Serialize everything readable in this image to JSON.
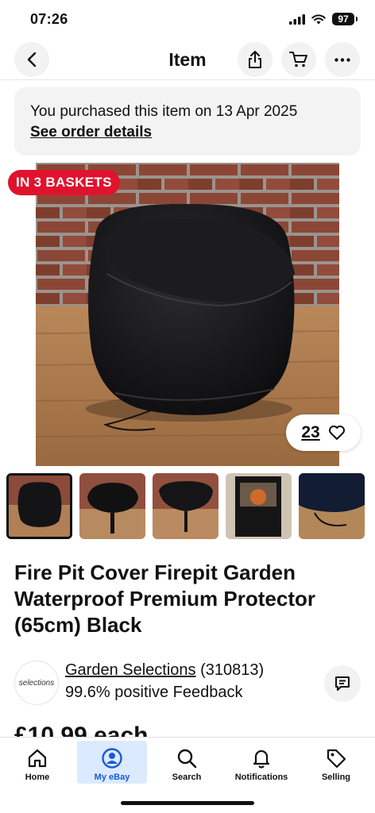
{
  "status_bar": {
    "time": "07:26",
    "battery": "97"
  },
  "nav": {
    "title": "Item",
    "back_icon": "chevron-left-icon",
    "share_icon": "share-icon",
    "cart_icon": "cart-icon",
    "more_icon": "more-icon"
  },
  "purchase": {
    "text": "You purchased this item on 13 Apr 2025",
    "link": "See order details"
  },
  "hero": {
    "badge": "IN 3 BASKETS",
    "watch_count": "23",
    "watch_icon": "heart-icon"
  },
  "thumbnails": [
    {
      "name": "thumb-cover-front",
      "selected": true
    },
    {
      "name": "thumb-cover-stand"
    },
    {
      "name": "thumb-cover-bowl"
    },
    {
      "name": "thumb-packaging"
    },
    {
      "name": "thumb-drawstring"
    }
  ],
  "product": {
    "title": "Fire Pit Cover Firepit Garden Waterproof Premium Protector (65cm) Black"
  },
  "seller": {
    "logo_text": "selections",
    "name": "Garden Selections",
    "count": "(310813)",
    "feedback": "99.6% positive Feedback"
  },
  "price_peek": "£10.99 each",
  "tabs": [
    {
      "label": "Home",
      "icon": "home-icon",
      "active": false
    },
    {
      "label": "My eBay",
      "icon": "user-icon",
      "active": true
    },
    {
      "label": "Search",
      "icon": "search-icon",
      "active": false
    },
    {
      "label": "Notifications",
      "icon": "bell-icon",
      "active": false
    },
    {
      "label": "Selling",
      "icon": "tag-icon",
      "active": false
    }
  ],
  "colors": {
    "badge_red": "#e0132e",
    "active_tab_bg": "#dbeaff",
    "active_tab_fg": "#1b59d9"
  }
}
